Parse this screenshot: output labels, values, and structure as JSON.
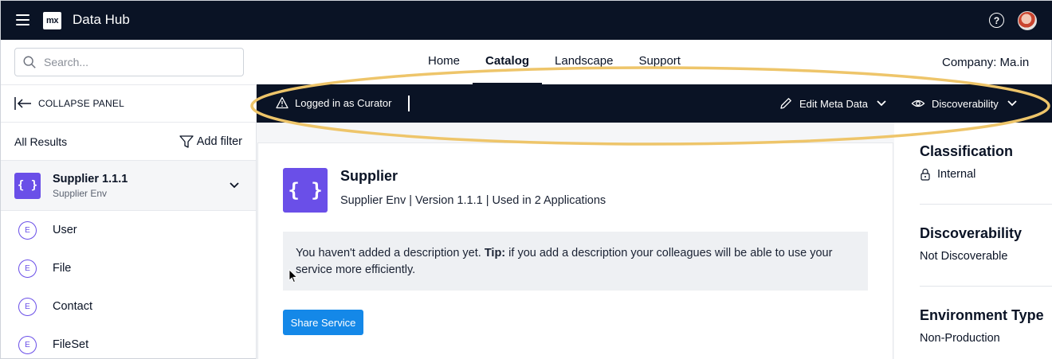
{
  "topbar": {
    "logo_text": "mx",
    "app_title": "Data Hub",
    "help_glyph": "?"
  },
  "search": {
    "placeholder": "Search..."
  },
  "nav": {
    "tabs": [
      {
        "label": "Home"
      },
      {
        "label": "Catalog",
        "active": true
      },
      {
        "label": "Landscape"
      },
      {
        "label": "Support"
      }
    ]
  },
  "company": {
    "label": "Company:  Ma.in"
  },
  "sidebar": {
    "collapse_label": "COLLAPSE PANEL",
    "results_label": "All Results",
    "filter_label": "Add filter",
    "selected": {
      "icon_text": "{ }",
      "title": "Supplier 1.1.1",
      "subtitle": "Supplier Env"
    },
    "entity_badge": "E",
    "entities": [
      "User",
      "File",
      "Contact",
      "FileSet"
    ]
  },
  "curator_bar": {
    "status_text": "Logged in as Curator",
    "edit_label": "Edit Meta Data",
    "discover_label": "Discoverability"
  },
  "service": {
    "icon_text": "{ }",
    "title": "Supplier",
    "meta": "Supplier Env | Version 1.1.1 | Used in 2 Applications",
    "desc_prefix": "You haven't added a description yet. ",
    "desc_tip_label": "Tip:",
    "desc_rest": " if you add a description your colleagues will be able to use your service more efficiently.",
    "share_label": "Share Service"
  },
  "right_panel": {
    "classification_head": "Classification",
    "classification_value": "Internal",
    "discoverability_head": "Discoverability",
    "discoverability_value": "Not Discoverable",
    "env_type_head": "Environment Type",
    "env_type_value": "Non-Production"
  },
  "colors": {
    "topbar": "#0a1325",
    "accent_purple": "#6a4fe8",
    "primary_button": "#1488e8",
    "highlight_ellipse": "#eec56a"
  }
}
